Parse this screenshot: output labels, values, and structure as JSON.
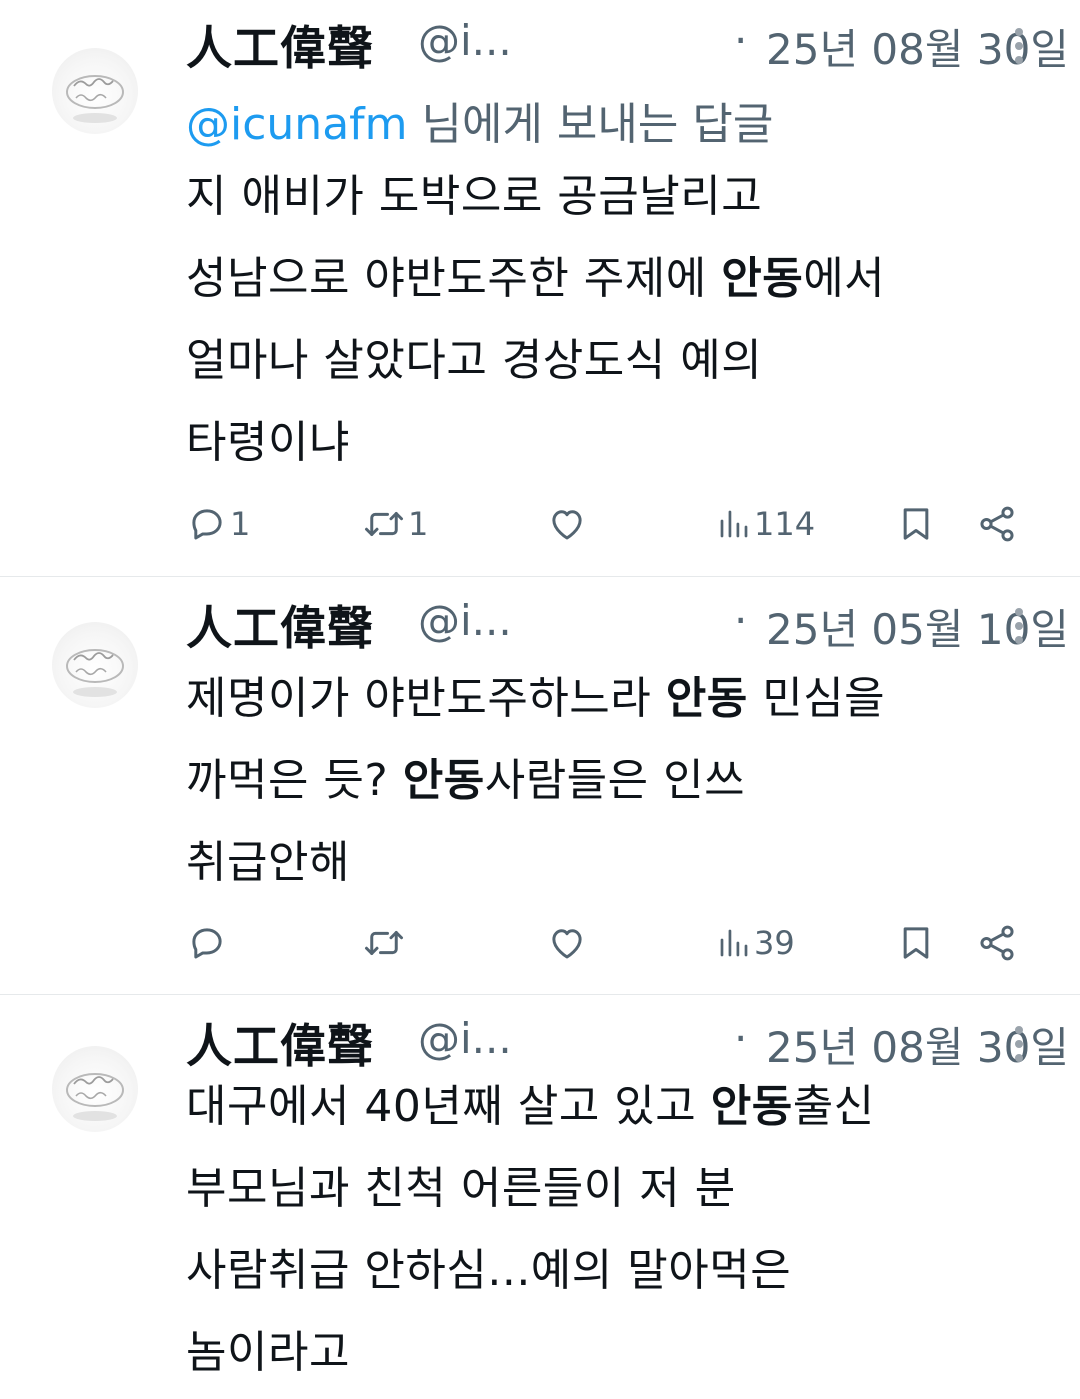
{
  "tweets": [
    {
      "author_name": "人工偉聲",
      "handle": "@i...",
      "separator": "·",
      "date": "25년 08월 30일",
      "reply_to": {
        "mention": "@icunafm",
        "suffix": " 님에게 보내는 답글"
      },
      "lines": [
        [
          {
            "t": "지 애비가 도박으로 공금날리고",
            "b": false
          }
        ],
        [
          {
            "t": "성남으로 야반도주한 주제에 ",
            "b": false
          },
          {
            "t": "안동",
            "b": true
          },
          {
            "t": "에서",
            "b": false
          }
        ],
        [
          {
            "t": "얼마나 살았다고 경상도식 예의",
            "b": false
          }
        ],
        [
          {
            "t": "타령이냐",
            "b": false
          }
        ]
      ],
      "stats": {
        "replies": "1",
        "retweets": "1",
        "likes": "",
        "views": "114"
      }
    },
    {
      "author_name": "人工偉聲",
      "handle": "@i...",
      "separator": "·",
      "date": "25년 05월 10일",
      "lines": [
        [
          {
            "t": "제명이가 야반도주하느라 ",
            "b": false
          },
          {
            "t": "안동",
            "b": true
          },
          {
            "t": " 민심을",
            "b": false
          }
        ],
        [
          {
            "t": "까먹은 듯? ",
            "b": false
          },
          {
            "t": "안동",
            "b": true
          },
          {
            "t": "사람들은 인쓰",
            "b": false
          }
        ],
        [
          {
            "t": "취급안해",
            "b": false
          }
        ]
      ],
      "stats": {
        "replies": "",
        "retweets": "",
        "likes": "",
        "views": "39"
      }
    },
    {
      "author_name": "人工偉聲",
      "handle": "@i...",
      "separator": "·",
      "date": "25년 08월 30일",
      "lines": [
        [
          {
            "t": "대구에서 40년째 살고 있고 ",
            "b": false
          },
          {
            "t": "안동",
            "b": true
          },
          {
            "t": "출신",
            "b": false
          }
        ],
        [
          {
            "t": "부모님과 친척 어른들이 저 분",
            "b": false
          }
        ],
        [
          {
            "t": "사람취급 안하심...예의 말아먹은",
            "b": false
          }
        ],
        [
          {
            "t": "놈이라고",
            "b": false
          }
        ]
      ]
    }
  ],
  "icons": {
    "avatar": "ring-avatar",
    "more": "more-vertical-icon",
    "reply": "reply-icon",
    "retweet": "retweet-icon",
    "like": "heart-icon",
    "views": "views-icon",
    "bookmark": "bookmark-icon",
    "share": "share-icon"
  },
  "colors": {
    "text": "#0f1419",
    "secondary": "#536471",
    "mention": "#1d9bf0",
    "divider": "#e6e9eb"
  }
}
